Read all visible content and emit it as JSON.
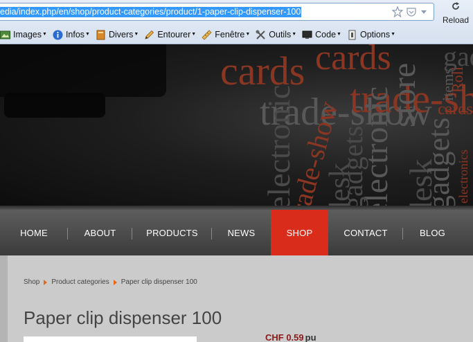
{
  "browser": {
    "url": "edia/index.php/en/shop/product-categories/product/1-paper-clip-dispenser-100",
    "reload_label": "Reload",
    "toolbar": [
      {
        "label": "Images",
        "icon": "image-icon"
      },
      {
        "label": "Infos",
        "icon": "info-icon"
      },
      {
        "label": "Divers",
        "icon": "book-icon"
      },
      {
        "label": "Entourer",
        "icon": "pencil-icon"
      },
      {
        "label": "Fenêtre",
        "icon": "ruler-icon"
      },
      {
        "label": "Outils",
        "icon": "tools-icon"
      },
      {
        "label": "Code",
        "icon": "monitor-icon"
      },
      {
        "label": "Options",
        "icon": "options-icon"
      }
    ]
  },
  "banner": {
    "words": [
      "cards",
      "trade-show",
      "trade-show",
      "trade-show",
      "cards",
      "cards",
      "items",
      "Roll",
      "gadgets",
      "electronics",
      "desk",
      "desk",
      "gadgets",
      "electronic",
      "electronic",
      "gadgets",
      "store"
    ]
  },
  "nav": {
    "items": [
      "HOME",
      "ABOUT",
      "PRODUCTS",
      "NEWS",
      "SHOP",
      "CONTACT",
      "BLOG"
    ],
    "active": "SHOP"
  },
  "breadcrumb": [
    "Shop",
    "Product categories",
    "Paper clip dispenser 100"
  ],
  "product": {
    "title": "Paper clip dispenser 100",
    "price": "CHF 0.59",
    "unit": "pu"
  },
  "colors": {
    "accent": "#d92c1b",
    "price": "#8b1818",
    "breadcrumb_arrow": "#e36a1a"
  }
}
